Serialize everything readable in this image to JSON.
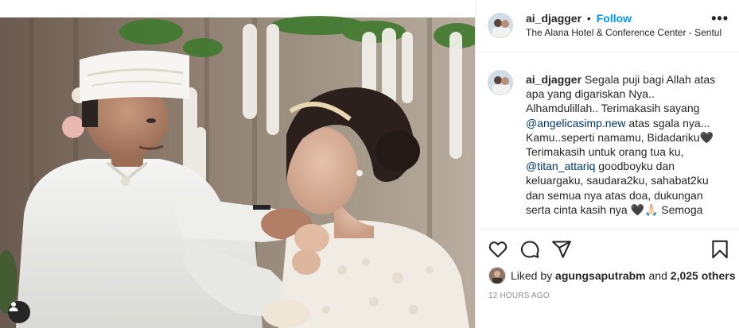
{
  "post": {
    "photo_alt": "Wedding photo",
    "tag_icon": "user-tag-icon"
  },
  "header": {
    "username": "ai_djagger",
    "separator": "•",
    "follow_label": "Follow",
    "location": "The Alana Hotel & Conference Center - Sentul",
    "more_icon": "more-options-icon",
    "more_label": "•••"
  },
  "caption": {
    "username": "ai_djagger",
    "text_1": " Segala puji bagi Allah atas apa yang digariskan Nya.. Alhamdulillah.. Terimakasih sayang ",
    "mention_1": "@angelicasimp.new",
    "text_2": " atas sgala nya... Kamu..seperti namamu, Bidadariku🖤",
    "text_3": "Terimakasih untuk orang tua ku, ",
    "mention_2": "@titan_attariq",
    "text_4": " goodboyku dan keluargaku, saudara2ku, sahabat2ku dan semua nya atas doa, dukungan serta cinta kasih nya 🖤🙏🏻 Semoga"
  },
  "actions": {
    "like_icon": "heart-icon",
    "comment_icon": "comment-icon",
    "share_icon": "share-icon",
    "save_icon": "bookmark-icon"
  },
  "likes": {
    "prefix": "Liked by ",
    "liker": "agungsaputrabm",
    "middle": " and ",
    "count": "2,025 others"
  },
  "timestamp": "12 HOURS AGO"
}
